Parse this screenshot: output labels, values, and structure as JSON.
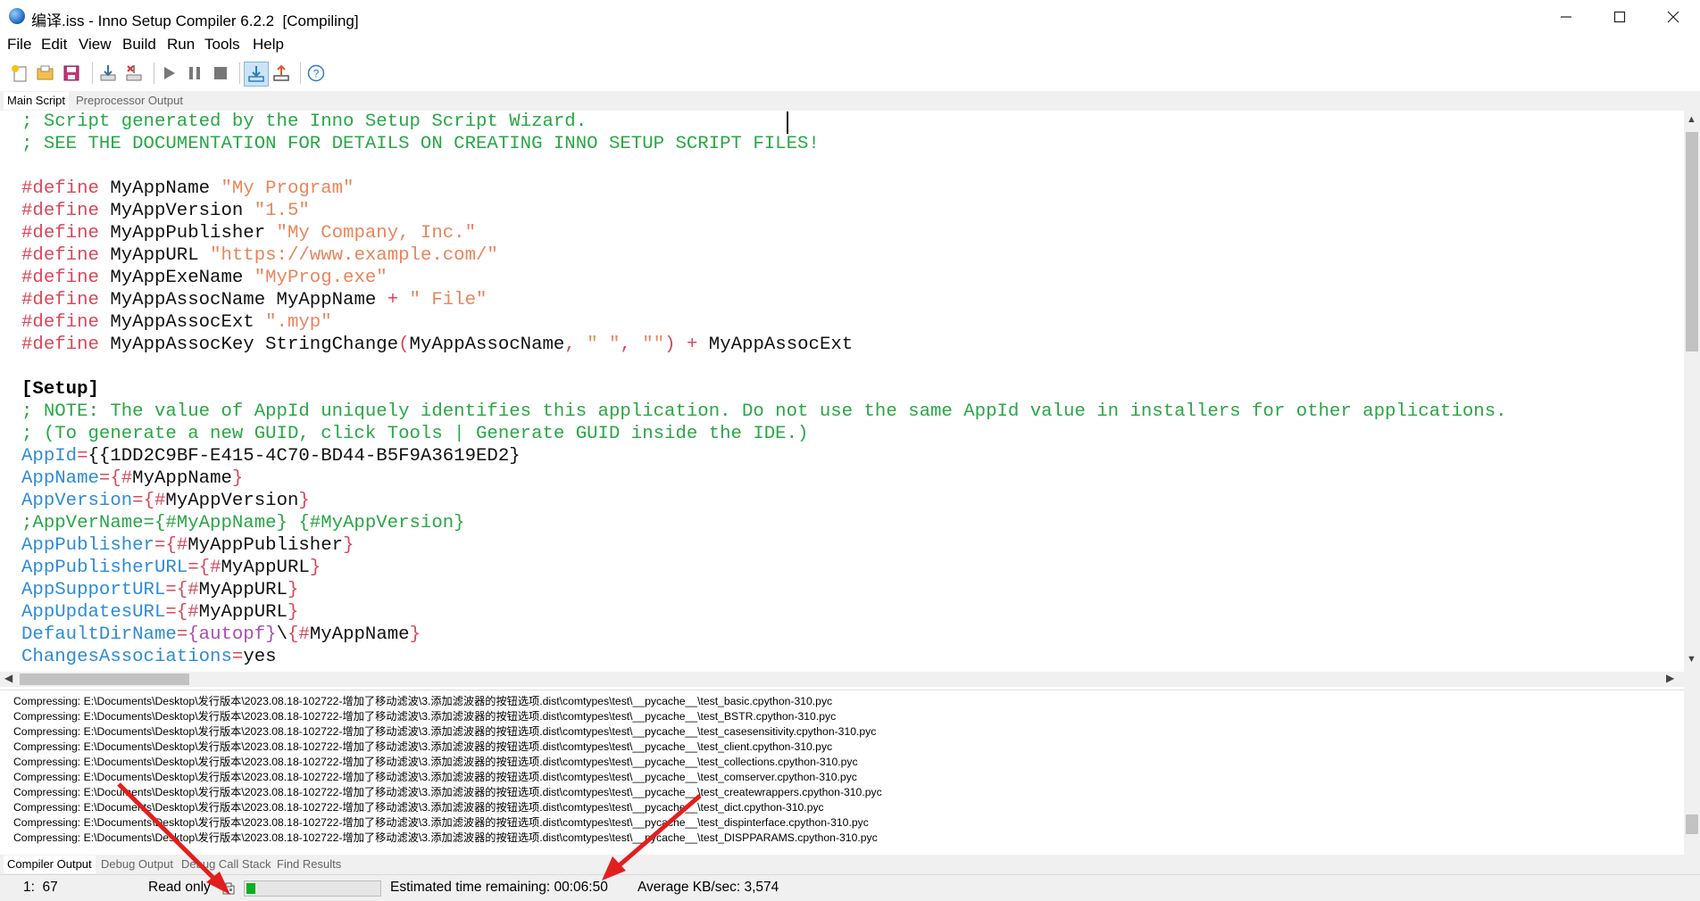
{
  "window": {
    "title": "编译.iss - Inno Setup Compiler 6.2.2  [Compiling]",
    "controls": [
      "minimize",
      "maximize",
      "close"
    ]
  },
  "menu": [
    "File",
    "Edit",
    "View",
    "Build",
    "Run",
    "Tools",
    "Help"
  ],
  "toolbar": {
    "icons": [
      "new-icon",
      "open-icon",
      "save-icon",
      "compile-icon",
      "stop-compile-icon",
      "run-icon",
      "pause-icon",
      "stop-icon",
      "target-download-icon",
      "target-upload-icon",
      "help-icon"
    ]
  },
  "top_tabs": [
    "Main Script",
    "Preprocessor Output"
  ],
  "editor": {
    "lines": [
      [
        {
          "t": "; Script generated by the Inno Setup Script Wizard.",
          "c": "com"
        }
      ],
      [
        {
          "t": "; SEE THE DOCUMENTATION FOR DETAILS ON CREATING INNO SETUP SCRIPT FILES!",
          "c": "com"
        }
      ],
      [],
      [
        {
          "t": "#define",
          "c": "kw"
        },
        {
          "t": " MyAppName ",
          "c": "txt"
        },
        {
          "t": "\"My Program\"",
          "c": "str"
        }
      ],
      [
        {
          "t": "#define",
          "c": "kw"
        },
        {
          "t": " MyAppVersion ",
          "c": "txt"
        },
        {
          "t": "\"1.5\"",
          "c": "str"
        }
      ],
      [
        {
          "t": "#define",
          "c": "kw"
        },
        {
          "t": " MyAppPublisher ",
          "c": "txt"
        },
        {
          "t": "\"My Company, Inc.\"",
          "c": "str"
        }
      ],
      [
        {
          "t": "#define",
          "c": "kw"
        },
        {
          "t": " MyAppURL ",
          "c": "txt"
        },
        {
          "t": "\"https://www.example.com/\"",
          "c": "str"
        }
      ],
      [
        {
          "t": "#define",
          "c": "kw"
        },
        {
          "t": " MyAppExeName ",
          "c": "txt"
        },
        {
          "t": "\"MyProg.exe\"",
          "c": "str"
        }
      ],
      [
        {
          "t": "#define",
          "c": "kw"
        },
        {
          "t": " MyAppAssocName MyAppName ",
          "c": "txt"
        },
        {
          "t": "+",
          "c": "sym"
        },
        {
          "t": " ",
          "c": "txt"
        },
        {
          "t": "\" File\"",
          "c": "str"
        }
      ],
      [
        {
          "t": "#define",
          "c": "kw"
        },
        {
          "t": " MyAppAssocExt ",
          "c": "txt"
        },
        {
          "t": "\".myp\"",
          "c": "str"
        }
      ],
      [
        {
          "t": "#define",
          "c": "kw"
        },
        {
          "t": " MyAppAssocKey StringChange",
          "c": "txt"
        },
        {
          "t": "(",
          "c": "sym"
        },
        {
          "t": "MyAppAssocName",
          "c": "txt"
        },
        {
          "t": ",",
          "c": "sym"
        },
        {
          "t": " ",
          "c": "txt"
        },
        {
          "t": "\" \"",
          "c": "str"
        },
        {
          "t": ",",
          "c": "sym"
        },
        {
          "t": " ",
          "c": "txt"
        },
        {
          "t": "\"\"",
          "c": "str"
        },
        {
          "t": ")",
          "c": "sym"
        },
        {
          "t": " ",
          "c": "txt"
        },
        {
          "t": "+",
          "c": "sym"
        },
        {
          "t": " MyAppAssocExt",
          "c": "txt"
        }
      ],
      [],
      [
        {
          "t": "[Setup]",
          "c": "sec"
        }
      ],
      [
        {
          "t": "; NOTE: The value of AppId uniquely identifies this application. Do not use the same AppId value in installers for other applications.",
          "c": "com"
        }
      ],
      [
        {
          "t": "; (To generate a new GUID, click Tools | Generate GUID inside the IDE.)",
          "c": "com"
        }
      ],
      [
        {
          "t": "AppId",
          "c": "key"
        },
        {
          "t": "=",
          "c": "sym"
        },
        {
          "t": "{{1DD2C9BF-E415-4C70-BD44-B5F9A3619ED2}",
          "c": "txt"
        }
      ],
      [
        {
          "t": "AppName",
          "c": "key"
        },
        {
          "t": "={",
          "c": "sym"
        },
        {
          "t": "#",
          "c": "sym"
        },
        {
          "t": "MyAppName",
          "c": "txt"
        },
        {
          "t": "}",
          "c": "sym"
        }
      ],
      [
        {
          "t": "AppVersion",
          "c": "key"
        },
        {
          "t": "={",
          "c": "sym"
        },
        {
          "t": "#",
          "c": "sym"
        },
        {
          "t": "MyAppVersion",
          "c": "txt"
        },
        {
          "t": "}",
          "c": "sym"
        }
      ],
      [
        {
          "t": ";AppVerName={#MyAppName} {#MyAppVersion}",
          "c": "com"
        }
      ],
      [
        {
          "t": "AppPublisher",
          "c": "key"
        },
        {
          "t": "={",
          "c": "sym"
        },
        {
          "t": "#",
          "c": "sym"
        },
        {
          "t": "MyAppPublisher",
          "c": "txt"
        },
        {
          "t": "}",
          "c": "sym"
        }
      ],
      [
        {
          "t": "AppPublisherURL",
          "c": "key"
        },
        {
          "t": "={",
          "c": "sym"
        },
        {
          "t": "#",
          "c": "sym"
        },
        {
          "t": "MyAppURL",
          "c": "txt"
        },
        {
          "t": "}",
          "c": "sym"
        }
      ],
      [
        {
          "t": "AppSupportURL",
          "c": "key"
        },
        {
          "t": "={",
          "c": "sym"
        },
        {
          "t": "#",
          "c": "sym"
        },
        {
          "t": "MyAppURL",
          "c": "txt"
        },
        {
          "t": "}",
          "c": "sym"
        }
      ],
      [
        {
          "t": "AppUpdatesURL",
          "c": "key"
        },
        {
          "t": "={",
          "c": "sym"
        },
        {
          "t": "#",
          "c": "sym"
        },
        {
          "t": "MyAppURL",
          "c": "txt"
        },
        {
          "t": "}",
          "c": "sym"
        }
      ],
      [
        {
          "t": "DefaultDirName",
          "c": "key"
        },
        {
          "t": "=",
          "c": "sym"
        },
        {
          "t": "{autopf}",
          "c": "const"
        },
        {
          "t": "\\",
          "c": "txt"
        },
        {
          "t": "{",
          "c": "sym"
        },
        {
          "t": "#",
          "c": "sym"
        },
        {
          "t": "MyAppName",
          "c": "txt"
        },
        {
          "t": "}",
          "c": "sym"
        }
      ],
      [
        {
          "t": "ChangesAssociations",
          "c": "key"
        },
        {
          "t": "=",
          "c": "sym"
        },
        {
          "t": "yes",
          "c": "txt"
        }
      ]
    ]
  },
  "output": {
    "lines": [
      "Compressing: E:\\Documents\\Desktop\\发行版本\\2023.08.18-102722-增加了移动滤波\\3.添加滤波器的按钮选项.dist\\comtypes\\test\\__pycache__\\test_basic.cpython-310.pyc",
      "Compressing: E:\\Documents\\Desktop\\发行版本\\2023.08.18-102722-增加了移动滤波\\3.添加滤波器的按钮选项.dist\\comtypes\\test\\__pycache__\\test_BSTR.cpython-310.pyc",
      "Compressing: E:\\Documents\\Desktop\\发行版本\\2023.08.18-102722-增加了移动滤波\\3.添加滤波器的按钮选项.dist\\comtypes\\test\\__pycache__\\test_casesensitivity.cpython-310.pyc",
      "Compressing: E:\\Documents\\Desktop\\发行版本\\2023.08.18-102722-增加了移动滤波\\3.添加滤波器的按钮选项.dist\\comtypes\\test\\__pycache__\\test_client.cpython-310.pyc",
      "Compressing: E:\\Documents\\Desktop\\发行版本\\2023.08.18-102722-增加了移动滤波\\3.添加滤波器的按钮选项.dist\\comtypes\\test\\__pycache__\\test_collections.cpython-310.pyc",
      "Compressing: E:\\Documents\\Desktop\\发行版本\\2023.08.18-102722-增加了移动滤波\\3.添加滤波器的按钮选项.dist\\comtypes\\test\\__pycache__\\test_comserver.cpython-310.pyc",
      "Compressing: E:\\Documents\\Desktop\\发行版本\\2023.08.18-102722-增加了移动滤波\\3.添加滤波器的按钮选项.dist\\comtypes\\test\\__pycache__\\test_createwrappers.cpython-310.pyc",
      "Compressing: E:\\Documents\\Desktop\\发行版本\\2023.08.18-102722-增加了移动滤波\\3.添加滤波器的按钮选项.dist\\comtypes\\test\\__pycache__\\test_dict.cpython-310.pyc",
      "Compressing: E:\\Documents\\Desktop\\发行版本\\2023.08.18-102722-增加了移动滤波\\3.添加滤波器的按钮选项.dist\\comtypes\\test\\__pycache__\\test_dispinterface.cpython-310.pyc",
      "Compressing: E:\\Documents\\Desktop\\发行版本\\2023.08.18-102722-增加了移动滤波\\3.添加滤波器的按钮选项.dist\\comtypes\\test\\__pycache__\\test_DISPPARAMS.cpython-310.pyc"
    ]
  },
  "bottom_tabs": [
    "Compiler Output",
    "Debug Output",
    "Debug Call Stack",
    "Find Results"
  ],
  "status": {
    "position": "1:  67",
    "mode": "Read only",
    "progress_fraction": 0.07,
    "estimated": "Estimated time remaining: 00:06:50",
    "average": "Average KB/sec: 3,574"
  },
  "colors": {
    "comment": "#28a745",
    "keyword": "#d9475a",
    "string": "#e8855d",
    "key": "#2e8bd8",
    "progress": "#06b025",
    "arrow": "#e31e1e"
  }
}
